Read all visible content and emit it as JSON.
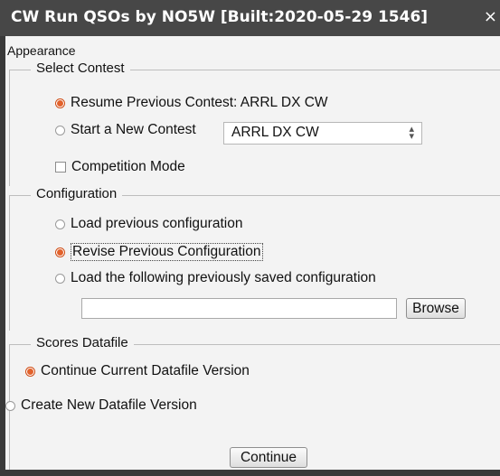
{
  "window": {
    "title": "CW Run QSOs by NO5W [Built:2020-05-29 1546]",
    "close_glyph": "×"
  },
  "menu": {
    "appearance": "Appearance"
  },
  "select_contest": {
    "title": "Select Contest",
    "resume_label": "Resume Previous Contest: ARRL DX CW",
    "resume_checked": true,
    "start_label": "Start a New Contest",
    "contest_value": "ARRL DX CW",
    "competition_label": "Competition Mode",
    "competition_checked": false
  },
  "configuration": {
    "title": "Configuration",
    "load_previous_label": "Load previous configuration",
    "revise_label": "Revise Previous Configuration",
    "revise_checked": true,
    "load_saved_label": "Load the following previously saved configuration",
    "path_value": "",
    "browse_label": "Browse"
  },
  "scores_datafile": {
    "title": "Scores Datafile",
    "continue_label": "Continue Current Datafile Version",
    "continue_checked": true,
    "create_label": "Create New Datafile Version"
  },
  "footer": {
    "continue_button": "Continue"
  },
  "colors": {
    "titlebar": "#474747",
    "radio_accent": "#e2622c",
    "panel_bg": "#f3f3f3"
  }
}
